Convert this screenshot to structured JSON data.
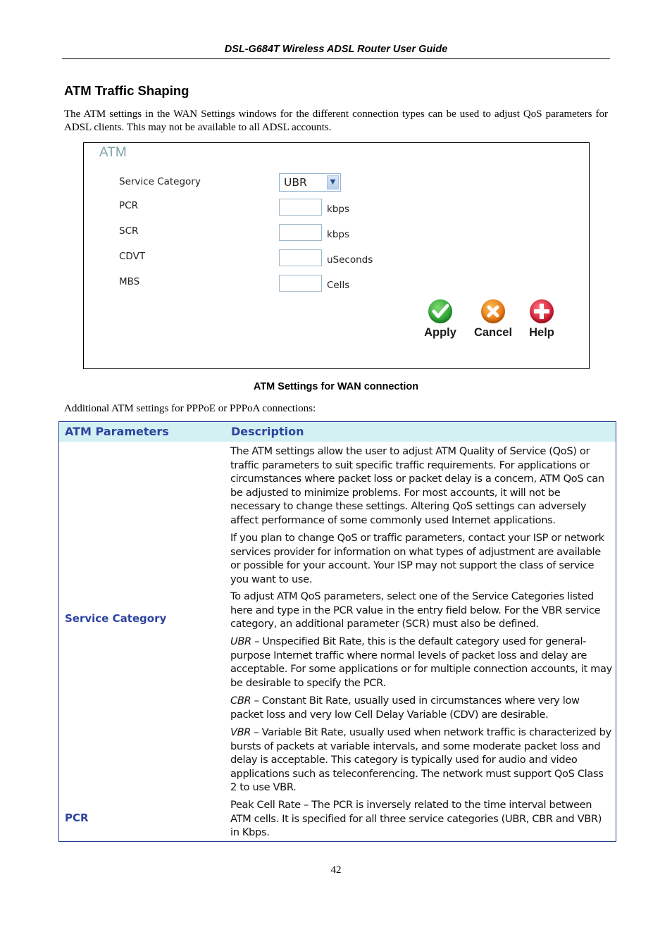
{
  "header": {
    "title": "DSL-G684T Wireless ADSL Router User Guide"
  },
  "section": {
    "title": "ATM Traffic Shaping",
    "intro": "The ATM settings in the WAN Settings windows for the different connection types can be used to adjust QoS parameters for ADSL clients. This may not be available to all ADSL accounts."
  },
  "atm_panel": {
    "title": "ATM",
    "service_category": {
      "label": "Service Category",
      "value": "UBR"
    },
    "fields": [
      {
        "label": "PCR",
        "value": "",
        "unit": "kbps"
      },
      {
        "label": "SCR",
        "value": "",
        "unit": "kbps"
      },
      {
        "label": "CDVT",
        "value": "",
        "unit": "uSeconds"
      },
      {
        "label": "MBS",
        "value": "",
        "unit": "Cells"
      }
    ],
    "buttons": {
      "apply": {
        "label": "Apply",
        "icon": "check-icon",
        "color": "#1f9a2b"
      },
      "cancel": {
        "label": "Cancel",
        "icon": "x-icon",
        "color": "#e06b0a"
      },
      "help": {
        "label": "Help",
        "icon": "plus-icon",
        "color": "#c8132a"
      }
    }
  },
  "caption": "ATM Settings for WAN connection",
  "sub_intro": "Additional ATM settings for PPPoE or PPPoA connections:",
  "table": {
    "headers": [
      "ATM Parameters",
      "Description"
    ],
    "rows": [
      {
        "param": "Service Category",
        "paragraphs": [
          {
            "lead": "",
            "text": "The ATM settings allow the user to adjust ATM Quality of Service (QoS) or traffic parameters to suit specific traffic requirements. For applications or circumstances where packet loss or packet delay is a concern, ATM QoS can be adjusted to minimize problems. For most accounts, it will not be necessary to change these settings. Altering QoS settings can adversely affect performance of some commonly used Internet applications."
          },
          {
            "lead": "",
            "text": "If you plan to change QoS or traffic parameters, contact your ISP or network services provider for information on what types of adjustment are available or possible for your account. Your ISP may not support the class of service you want to use."
          },
          {
            "lead": "",
            "text": "To adjust ATM QoS parameters, select one of the Service Categories listed here and type in the PCR value in the entry field below. For the VBR service category, an additional parameter (SCR) must also be defined."
          },
          {
            "lead": "UBR",
            "text": " – Unspecified Bit Rate, this is the default category used for general-purpose Internet traffic where normal levels of packet loss and delay are acceptable. For some applications or for multiple connection accounts, it may be desirable to specify the PCR."
          },
          {
            "lead": "CBR",
            "text": " – Constant Bit Rate, usually used in circumstances where very low packet loss and very low Cell Delay Variable (CDV) are desirable."
          },
          {
            "lead": "VBR",
            "text": " – Variable Bit Rate, usually used when network traffic is characterized by bursts of packets at variable intervals, and some moderate packet loss and delay is acceptable. This category is typically used for audio and video applications such as teleconferencing. The network must support QoS Class 2 to use VBR."
          }
        ]
      },
      {
        "param": "PCR",
        "paragraphs": [
          {
            "lead": "",
            "text": "Peak Cell Rate – The PCR is inversely related to the time interval between ATM cells. It is specified for all three service categories (UBR, CBR and VBR) in Kbps."
          }
        ]
      }
    ]
  },
  "page_number": "42"
}
